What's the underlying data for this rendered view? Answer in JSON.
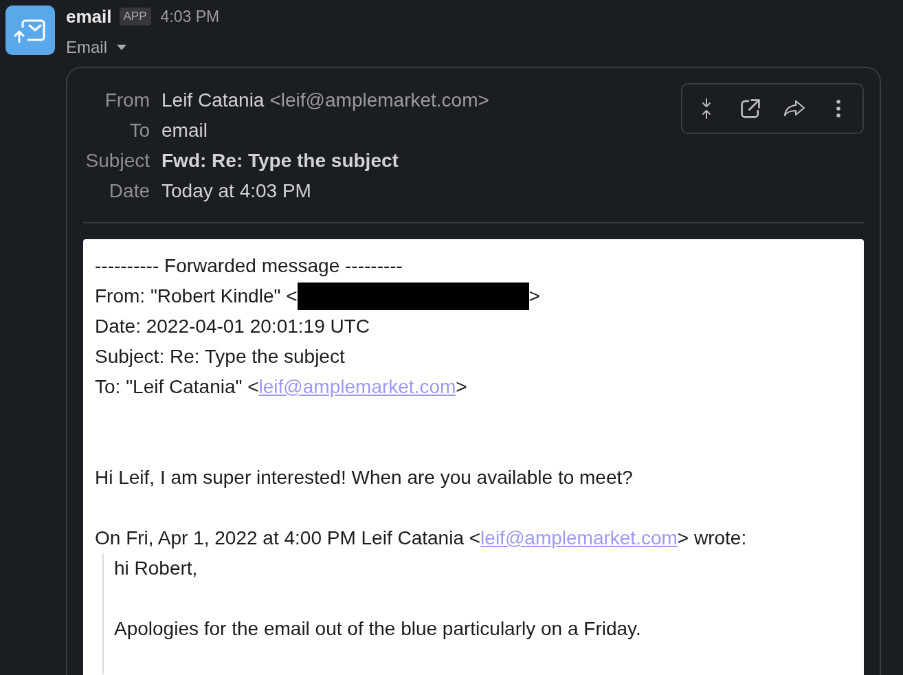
{
  "message": {
    "app_name": "email",
    "badge": "APP",
    "time": "4:03 PM",
    "channel": "Email"
  },
  "email": {
    "headers": [
      {
        "kind": "sender",
        "label": "From",
        "value": "Leif Catania",
        "address": "<leif@amplemarket.com>"
      },
      {
        "kind": "plain",
        "label": "To",
        "value": "email"
      },
      {
        "kind": "subject",
        "label": "Subject",
        "value": "Fwd: Re: Type the subject"
      },
      {
        "kind": "plain",
        "label": "Date",
        "value": "Today at 4:03 PM"
      }
    ],
    "body": [
      {
        "kind": "text",
        "text": "---------- Forwarded message ---------"
      },
      {
        "kind": "redacted",
        "before": "From: \"Robert Kindle\" <",
        "after": ">"
      },
      {
        "kind": "text",
        "text": "Date: 2022-04-01 20:01:19 UTC"
      },
      {
        "kind": "text",
        "text": "Subject: Re: Type the subject"
      },
      {
        "kind": "link",
        "before": "To: \"Leif Catania\" <",
        "link": "leif@amplemarket.com",
        "after": ">"
      },
      {
        "kind": "blank"
      },
      {
        "kind": "blank"
      },
      {
        "kind": "text",
        "text": "Hi Leif, I am super interested! When are you available to meet?"
      },
      {
        "kind": "blank"
      },
      {
        "kind": "link",
        "before": "On Fri, Apr 1, 2022 at 4:00 PM Leif Catania <",
        "link": "leif@amplemarket.com",
        "after": "> wrote:"
      },
      {
        "kind": "quote",
        "children": [
          {
            "kind": "text",
            "text": "hi Robert,"
          },
          {
            "kind": "blank"
          },
          {
            "kind": "text",
            "text": "Apologies for the email out of the blue particularly on a Friday."
          },
          {
            "kind": "blank"
          }
        ]
      }
    ]
  }
}
